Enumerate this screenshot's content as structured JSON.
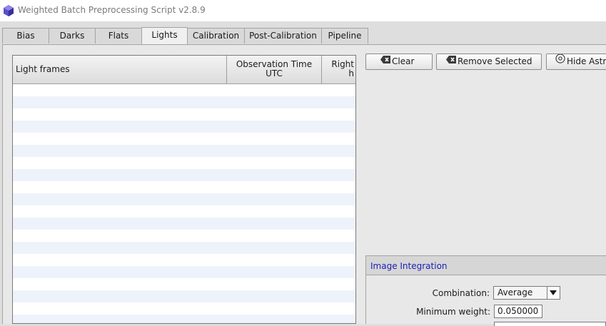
{
  "window": {
    "title": "Weighted Batch Preprocessing Script v2.8.9"
  },
  "tabs": [
    {
      "label": "Bias"
    },
    {
      "label": "Darks"
    },
    {
      "label": "Flats"
    },
    {
      "label": "Lights",
      "active": true
    },
    {
      "label": "Calibration"
    },
    {
      "label": "Post-Calibration"
    },
    {
      "label": "Pipeline"
    }
  ],
  "file_list": {
    "columns": [
      {
        "label": "Light frames"
      },
      {
        "line1": "Observation Time",
        "line2": "UTC"
      },
      {
        "line1": "Right",
        "line2": "h"
      }
    ],
    "rows": []
  },
  "buttons": {
    "clear": "Clear",
    "remove_selected": "Remove Selected",
    "hide_astrometry": "Hide Astr"
  },
  "image_integration": {
    "title": "Image Integration",
    "combination_label": "Combination:",
    "combination_value": "Average",
    "min_weight_label": "Minimum weight:",
    "min_weight_value": "0.050000"
  },
  "colors": {
    "section_title": "#1c1cb8",
    "row_alt": "#eef3fb"
  }
}
